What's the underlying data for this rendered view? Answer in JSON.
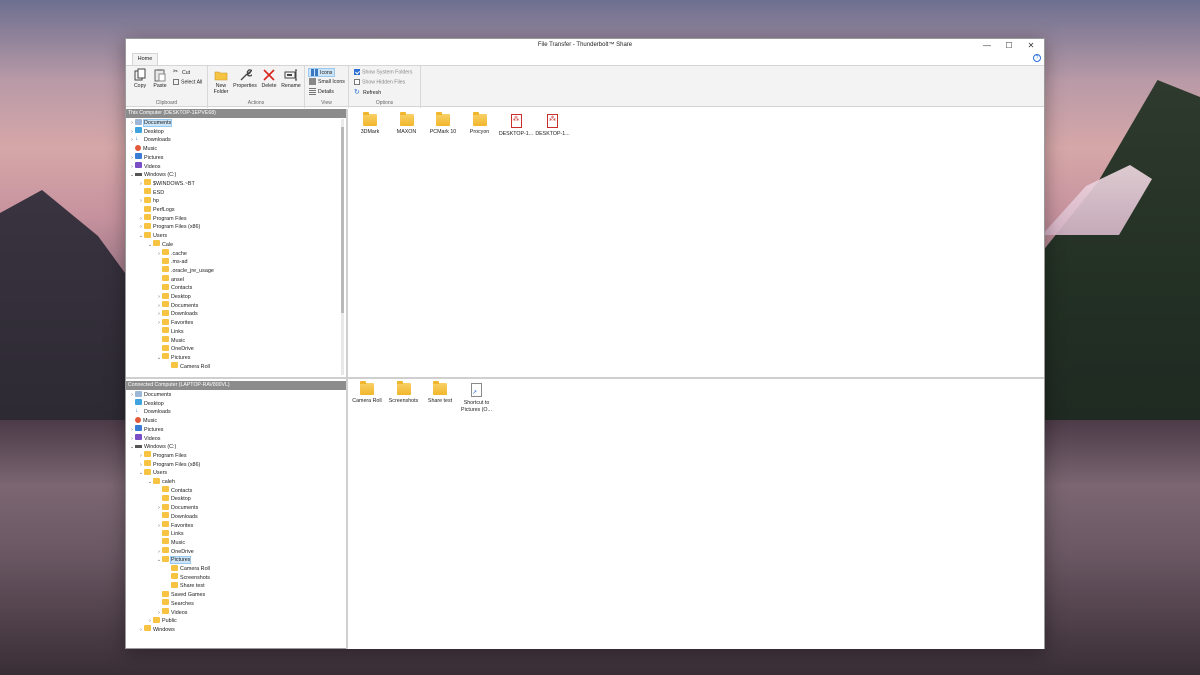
{
  "window": {
    "title": "File Transfer - Thunderbolt™ Share"
  },
  "window_buttons": {
    "minimize": "—",
    "maximize": "☐",
    "close": "✕"
  },
  "tabs": {
    "home": "Home",
    "help": "?"
  },
  "ribbon": {
    "clipboard": {
      "copy": "Copy",
      "paste": "Paste",
      "cut": "Cut",
      "select_all": "Select All",
      "label": "Clipboard"
    },
    "actions": {
      "new_folder": "New Folder",
      "properties": "Properties",
      "delete": "Delete",
      "rename": "Rename",
      "label": "Actions"
    },
    "view": {
      "icons": "Icons",
      "small_icons": "Small Icons",
      "details": "Details",
      "label": "View"
    },
    "options": {
      "show_system_folders": "Show System Folders",
      "show_system_folders_checked": true,
      "show_hidden_files": "Show Hidden Files",
      "show_hidden_files_checked": false,
      "refresh": "Refresh",
      "label": "Options"
    }
  },
  "this_computer": {
    "header": "This Computer (DESKTOP-1EPVE68)",
    "tree": [
      {
        "label": "Documents",
        "icon": "documents-folder-icon",
        "chev": ">",
        "indent": 0,
        "selected": true
      },
      {
        "label": "Desktop",
        "icon": "desktop-folder-icon",
        "chev": ">",
        "indent": 0
      },
      {
        "label": "Downloads",
        "icon": "download-icon",
        "chev": ">",
        "indent": 0
      },
      {
        "label": "Music",
        "icon": "music-icon",
        "chev": "",
        "indent": 0
      },
      {
        "label": "Pictures",
        "icon": "pictures-folder-icon",
        "chev": ">",
        "indent": 0
      },
      {
        "label": "Videos",
        "icon": "videos-folder-icon",
        "chev": ">",
        "indent": 0
      },
      {
        "label": "Windows (C:)",
        "icon": "drive-icon",
        "chev": "v",
        "indent": 0
      },
      {
        "label": "$WINDOWS.~BT",
        "icon": "folder-icon",
        "chev": ">",
        "indent": 1
      },
      {
        "label": "ESD",
        "icon": "folder-icon",
        "chev": "",
        "indent": 1
      },
      {
        "label": "hp",
        "icon": "folder-icon",
        "chev": ">",
        "indent": 1
      },
      {
        "label": "PerfLogs",
        "icon": "folder-icon",
        "chev": "",
        "indent": 1
      },
      {
        "label": "Program Files",
        "icon": "folder-icon",
        "chev": ">",
        "indent": 1
      },
      {
        "label": "Program Files (x86)",
        "icon": "folder-icon",
        "chev": ">",
        "indent": 1
      },
      {
        "label": "Users",
        "icon": "folder-icon",
        "chev": "v",
        "indent": 1
      },
      {
        "label": "Cale",
        "icon": "folder-icon",
        "chev": "v",
        "indent": 2
      },
      {
        "label": ".cache",
        "icon": "folder-icon",
        "chev": ">",
        "indent": 3
      },
      {
        "label": ".ms-ad",
        "icon": "folder-icon",
        "chev": "",
        "indent": 3
      },
      {
        "label": ".oracle_jre_usage",
        "icon": "folder-icon",
        "chev": "",
        "indent": 3
      },
      {
        "label": "ansel",
        "icon": "folder-icon",
        "chev": "",
        "indent": 3
      },
      {
        "label": "Contacts",
        "icon": "folder-icon",
        "chev": "",
        "indent": 3
      },
      {
        "label": "Desktop",
        "icon": "folder-icon",
        "chev": ">",
        "indent": 3
      },
      {
        "label": "Documents",
        "icon": "folder-icon",
        "chev": ">",
        "indent": 3
      },
      {
        "label": "Downloads",
        "icon": "folder-icon",
        "chev": ">",
        "indent": 3
      },
      {
        "label": "Favorites",
        "icon": "folder-icon",
        "chev": ">",
        "indent": 3
      },
      {
        "label": "Links",
        "icon": "folder-icon",
        "chev": "",
        "indent": 3
      },
      {
        "label": "Music",
        "icon": "folder-icon",
        "chev": "",
        "indent": 3
      },
      {
        "label": "OneDrive",
        "icon": "folder-icon",
        "chev": "",
        "indent": 3
      },
      {
        "label": "Pictures",
        "icon": "folder-icon",
        "chev": "v",
        "indent": 3
      },
      {
        "label": "Camera Roll",
        "icon": "folder-icon",
        "chev": "",
        "indent": 4
      }
    ],
    "files": [
      {
        "label": "3DMark",
        "type": "folder"
      },
      {
        "label": "MAXON",
        "type": "folder"
      },
      {
        "label": "PCMark 10",
        "type": "folder"
      },
      {
        "label": "Procyon",
        "type": "folder"
      },
      {
        "label": "DESKTOP-1...",
        "type": "pdf"
      },
      {
        "label": "DESKTOP-1...",
        "type": "pdf"
      }
    ]
  },
  "connected_computer": {
    "header": "Connected Computer (LAPTOP-RAV800VL)",
    "tree": [
      {
        "label": "Documents",
        "icon": "documents-folder-icon",
        "chev": ">",
        "indent": 0
      },
      {
        "label": "Desktop",
        "icon": "desktop-folder-icon",
        "chev": "",
        "indent": 0
      },
      {
        "label": "Downloads",
        "icon": "download-icon",
        "chev": "",
        "indent": 0
      },
      {
        "label": "Music",
        "icon": "music-icon",
        "chev": "",
        "indent": 0
      },
      {
        "label": "Pictures",
        "icon": "pictures-folder-icon",
        "chev": ">",
        "indent": 0
      },
      {
        "label": "Videos",
        "icon": "videos-folder-icon",
        "chev": ">",
        "indent": 0
      },
      {
        "label": "Windows (C:)",
        "icon": "drive-icon",
        "chev": "v",
        "indent": 0
      },
      {
        "label": "Program Files",
        "icon": "folder-icon",
        "chev": ">",
        "indent": 1
      },
      {
        "label": "Program Files (x86)",
        "icon": "folder-icon",
        "chev": ">",
        "indent": 1
      },
      {
        "label": "Users",
        "icon": "folder-icon",
        "chev": "v",
        "indent": 1
      },
      {
        "label": "caleh",
        "icon": "folder-icon",
        "chev": "v",
        "indent": 2
      },
      {
        "label": "Contacts",
        "icon": "folder-icon",
        "chev": "",
        "indent": 3
      },
      {
        "label": "Desktop",
        "icon": "folder-icon",
        "chev": "",
        "indent": 3
      },
      {
        "label": "Documents",
        "icon": "folder-icon",
        "chev": ">",
        "indent": 3
      },
      {
        "label": "Downloads",
        "icon": "folder-icon",
        "chev": "",
        "indent": 3
      },
      {
        "label": "Favorites",
        "icon": "folder-icon",
        "chev": ">",
        "indent": 3
      },
      {
        "label": "Links",
        "icon": "folder-icon",
        "chev": "",
        "indent": 3
      },
      {
        "label": "Music",
        "icon": "folder-icon",
        "chev": "",
        "indent": 3
      },
      {
        "label": "OneDrive",
        "icon": "folder-icon",
        "chev": ">",
        "indent": 3
      },
      {
        "label": "Pictures",
        "icon": "folder-icon",
        "chev": "v",
        "indent": 3,
        "selected": true
      },
      {
        "label": "Camera Roll",
        "icon": "folder-icon",
        "chev": "",
        "indent": 4
      },
      {
        "label": "Screenshots",
        "icon": "folder-icon",
        "chev": "",
        "indent": 4
      },
      {
        "label": "Share test",
        "icon": "folder-icon",
        "chev": "",
        "indent": 4
      },
      {
        "label": "Saved Games",
        "icon": "folder-icon",
        "chev": "",
        "indent": 3
      },
      {
        "label": "Searches",
        "icon": "folder-icon",
        "chev": "",
        "indent": 3
      },
      {
        "label": "Videos",
        "icon": "folder-icon",
        "chev": ">",
        "indent": 3
      },
      {
        "label": "Public",
        "icon": "folder-icon",
        "chev": ">",
        "indent": 2
      },
      {
        "label": "Windows",
        "icon": "folder-icon",
        "chev": ">",
        "indent": 1
      }
    ],
    "files": [
      {
        "label": "Camera Roll",
        "type": "folder"
      },
      {
        "label": "Screenshots",
        "type": "folder"
      },
      {
        "label": "Share test",
        "type": "folder"
      },
      {
        "label": "Shortcut to Pictures (O...",
        "type": "shortcut"
      }
    ]
  }
}
